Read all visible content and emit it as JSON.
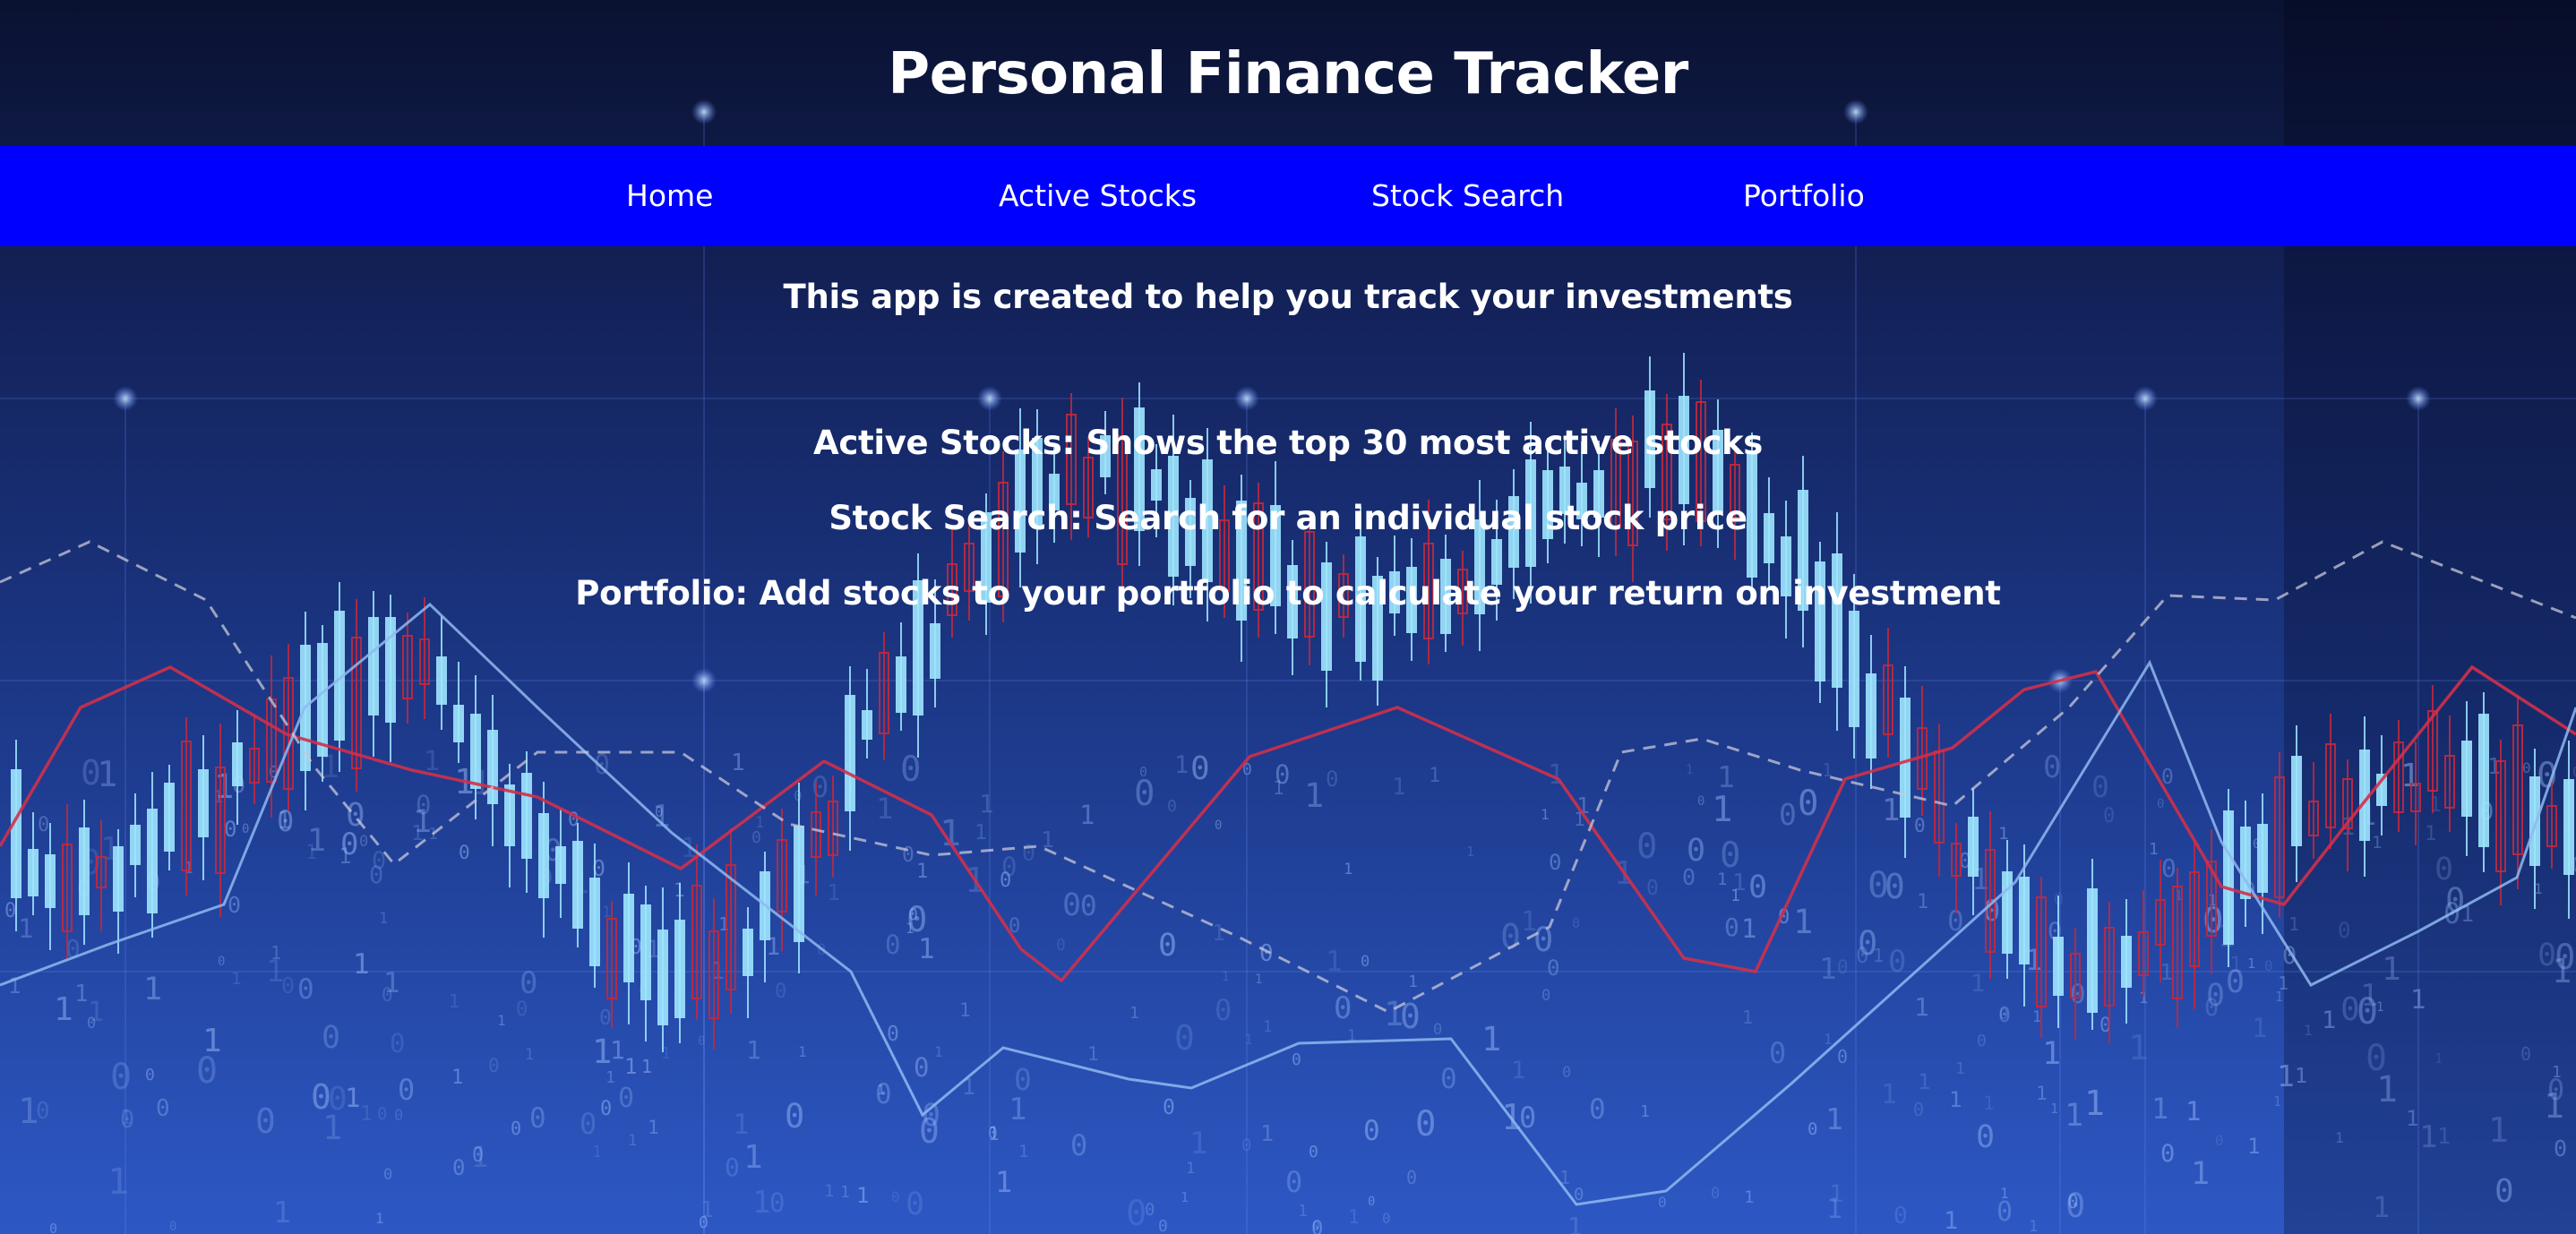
{
  "header": {
    "title": "Personal Finance Tracker"
  },
  "nav": {
    "items": [
      {
        "label": "Home"
      },
      {
        "label": "Active Stocks"
      },
      {
        "label": "Stock Search"
      },
      {
        "label": "Portfolio"
      }
    ]
  },
  "main": {
    "intro": "This app is created to help you track your investments",
    "descriptions": [
      "Active Stocks: Shows the top 30 most active stocks",
      "Stock Search: Search for an individual stock price",
      "Portfolio: Add stocks to your portfolio to calculate your return on investment"
    ]
  },
  "colors": {
    "nav_bg": "#0000ff",
    "page_bg_top": "#0a1433",
    "page_bg_bottom": "#2a4fb0",
    "candle_up": "#9fe6ff",
    "candle_down": "#c4283c",
    "red_line": "#d0304a",
    "blue_line": "#8fb8f0",
    "dashed_line": "#c8c8d8"
  }
}
